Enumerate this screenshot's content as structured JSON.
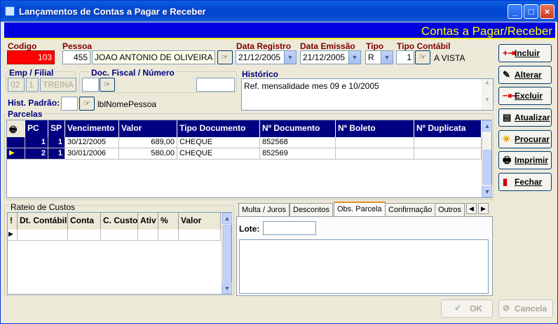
{
  "window": {
    "title": "Lançamentos de Contas a Pagar e Receber",
    "min": "_",
    "max": "□",
    "close": "×"
  },
  "header": {
    "title": "Contas a Pagar/Receber"
  },
  "form": {
    "codigo_label": "Codigo",
    "codigo_value": "103",
    "pessoa_label": "Pessoa",
    "pessoa_id": "455",
    "pessoa_nome": "JOAO ANTONIO DE OLIVEIRA",
    "data_registro_label": "Data Registro",
    "data_registro": "21/12/2005",
    "data_emissao_label": "Data Emissão",
    "data_emissao": "21/12/2005",
    "tipo_label": "Tipo",
    "tipo": "R",
    "tipo_contabil_label": "Tipo Contábil",
    "tipo_contabil_id": "1",
    "tipo_contabil_nome": "A VISTA",
    "emp_filial_label": "Emp / Filial",
    "emp": "02",
    "filial": "1",
    "filial_nome": "TREINA",
    "doc_fiscal_label": "Doc. Fiscal / Número",
    "doc_fiscal": "",
    "doc_numero": "",
    "historico_label": "Histórico",
    "historico": "Ref. mensalidade mes 09 e 10/2005",
    "hist_padrao_label": "Hist. Padrão:",
    "hist_padrao": "",
    "hist_padrao_nome": "lblNomePessoa"
  },
  "parcelas": {
    "label": "Parcelas",
    "columns": [
      "PC",
      "SP",
      "Vencimento",
      "Valor",
      "Tipo Documento",
      "Nº Documento",
      "Nº Boleto",
      "Nº Duplicata"
    ],
    "rows": [
      {
        "pc": "1",
        "sp": "1",
        "vencimento": "30/12/2005",
        "valor": "689,00",
        "tipo": "CHEQUE",
        "documento": "852568",
        "boleto": "",
        "duplicata": ""
      },
      {
        "pc": "2",
        "sp": "1",
        "vencimento": "30/01/2006",
        "valor": "580,00",
        "tipo": "CHEQUE",
        "documento": "852569",
        "boleto": "",
        "duplicata": ""
      }
    ]
  },
  "rateio": {
    "label": "Rateio de Custos",
    "columns": [
      "Dt. Contábil",
      "Conta",
      "C. Custo",
      "Ativ",
      "%",
      "Valor"
    ]
  },
  "tabs": {
    "items": [
      "Multa / Juros",
      "Descontos",
      "Obs. Parcela",
      "Confirmação",
      "Outros"
    ],
    "active": "Obs. Parcela",
    "lote_label": "Lote:",
    "lote": ""
  },
  "side": {
    "incluir": "Incluir",
    "alterar": "Alterar",
    "excluir": "Excluir",
    "atualizar": "Atualizar",
    "procurar": "Procurar",
    "imprimir": "Imprimir",
    "fechar": "Fechar"
  },
  "bottom": {
    "ok": "OK",
    "cancela": "Cancela"
  },
  "colors": {
    "title_bar": "#0348d1",
    "header_bg": "#0000e0",
    "header_text": "#ffff00",
    "grid_header": "#000080",
    "codigo_bg": "#ff0000"
  }
}
